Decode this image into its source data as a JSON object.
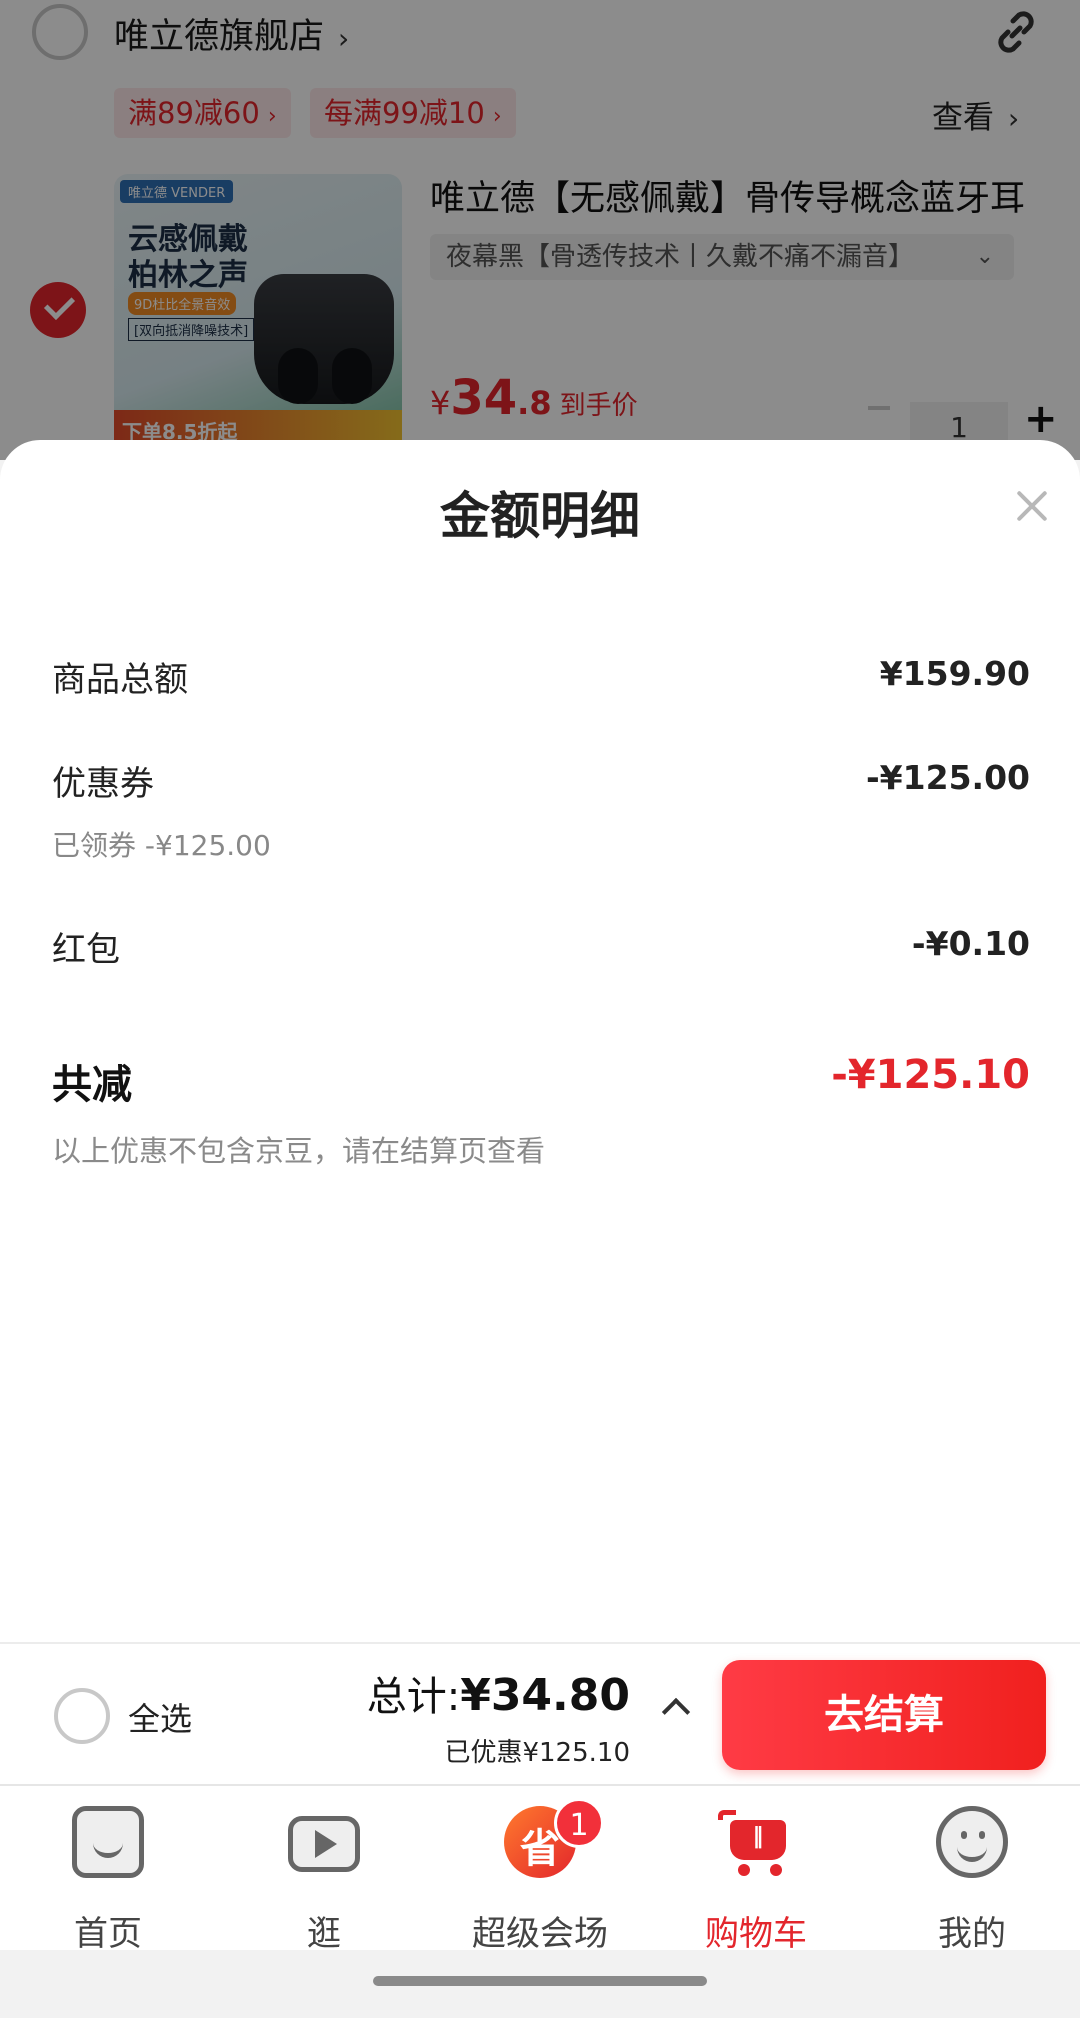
{
  "background_cart": {
    "store_name": "唯立德旗舰店",
    "store_chevron": "›",
    "promos": [
      {
        "label": "满89减60",
        "arrow": "›"
      },
      {
        "label": "每满99减10",
        "arrow": "›"
      }
    ],
    "view_label": "查看",
    "view_chevron": "›",
    "product": {
      "title": "唯立德【无感佩戴】骨传导概念蓝牙耳",
      "sku": "夜幕黑【骨透传技术丨久戴不痛不漏音】",
      "sku_dropdown": "⌄",
      "price_symbol": "¥",
      "price_int": "34",
      "price_dec": ".8",
      "price_label": "到手价",
      "quantity": "1",
      "qty_plus": "+",
      "image": {
        "brand_tag": "唯立德 VENDER",
        "headline_line1": "云感佩戴",
        "headline_line2": "柏林之声",
        "tag1": "9D杜比全景音效",
        "tag2": "[双向抵消降噪技术]",
        "bottom_text": "下单8.5折起"
      }
    },
    "link_icon": "link-icon"
  },
  "sheet": {
    "title": "金额明细",
    "rows": {
      "goods_total": {
        "label": "商品总额",
        "value": "¥159.90"
      },
      "coupon": {
        "label": "优惠券",
        "value": "-¥125.00",
        "note": "已领券 -¥125.00"
      },
      "red_packet": {
        "label": "红包",
        "value": "-¥0.10"
      }
    },
    "total_discount": {
      "label": "共减",
      "value": "-¥125.10"
    },
    "footnote": "以上优惠不包含京豆，请在结算页查看"
  },
  "checkout": {
    "select_all": "全选",
    "sum_label": "总计:",
    "sum_amount": "¥34.80",
    "saved": "已优惠¥125.10",
    "button": "去结算"
  },
  "tabs": [
    {
      "label": "首页",
      "icon": "home-icon"
    },
    {
      "label": "逛",
      "icon": "video-icon"
    },
    {
      "label": "超级会场",
      "icon": "venue-icon",
      "icon_text": "省",
      "badge": "1"
    },
    {
      "label": "购物车",
      "icon": "cart-icon",
      "active": true
    },
    {
      "label": "我的",
      "icon": "profile-icon"
    }
  ],
  "colors": {
    "accent": "#e3262c",
    "checkout_gradient_start": "#ff3b45",
    "checkout_gradient_end": "#f0201e",
    "muted_text": "#888888"
  }
}
